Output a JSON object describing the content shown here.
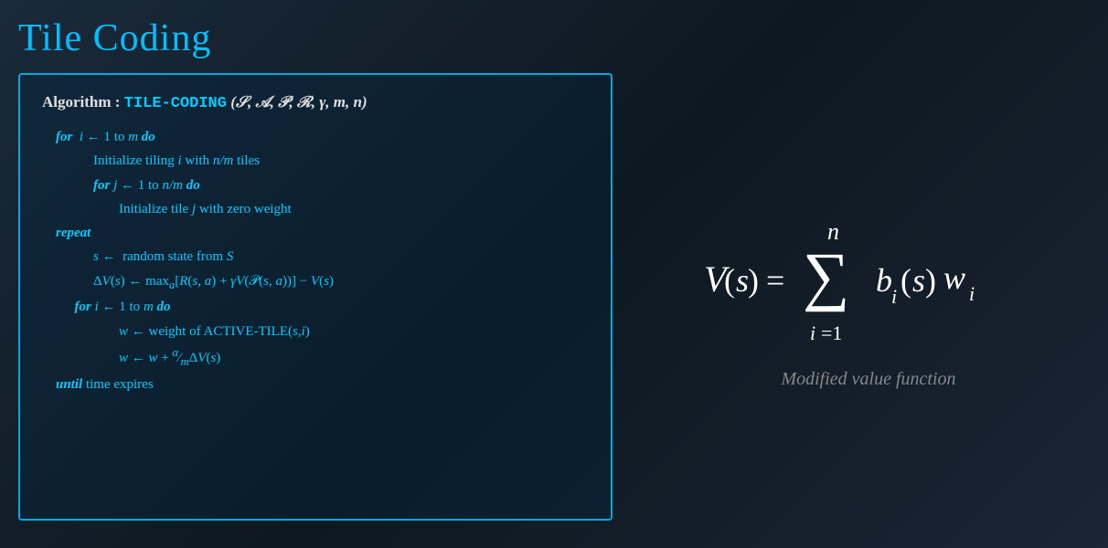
{
  "title": "Tile Coding",
  "algorithm": {
    "header_bold": "Algorithm : ",
    "name": "TILE-CODING",
    "params": "(𝒮, 𝒜, 𝒫, ℛ, γ, m, n)",
    "lines": [
      {
        "indent": 0,
        "text": "for  i ← 1 to m do"
      },
      {
        "indent": 1,
        "text": "Initialize tiling i with n/m tiles"
      },
      {
        "indent": 1,
        "text": "for j ← 1 to n/m do"
      },
      {
        "indent": 2,
        "text": "Initialize tile j with zero weight"
      },
      {
        "indent": 0,
        "text": "repeat"
      },
      {
        "indent": 1,
        "text": "s ←  random state from S"
      },
      {
        "indent": 1,
        "text": "ΔV(s) ← maxₐ[R(s, a) + γV(𝒫(s, a))] − V(s)"
      },
      {
        "indent": 1,
        "text": "for i ← 1 to m do"
      },
      {
        "indent": 2,
        "text": "w ← weight of ACTIVE-TILE(s, i)"
      },
      {
        "indent": 2,
        "text": "w ← w + (α/m)ΔV(s)"
      },
      {
        "indent": 0,
        "text": "until time expires"
      }
    ]
  },
  "formula_label": "Modified value function"
}
